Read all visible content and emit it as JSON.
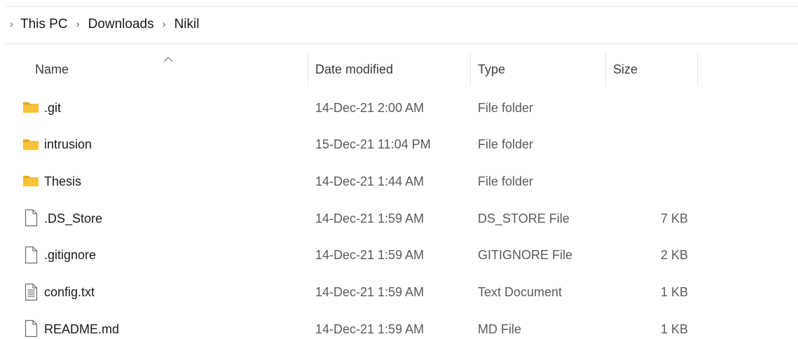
{
  "breadcrumb": {
    "items": [
      "This PC",
      "Downloads",
      "Nikil"
    ]
  },
  "columns": {
    "name": "Name",
    "date_modified": "Date modified",
    "type": "Type",
    "size": "Size"
  },
  "sort": {
    "column": "name",
    "direction": "ascending"
  },
  "colors": {
    "folder": "#f8c23a",
    "folder_dark": "#e3a81b",
    "file_outline": "#6b6b6b",
    "text": "#1a1a1a",
    "muted_text": "#5a5a5a"
  },
  "files": [
    {
      "name": ".git",
      "date": "14-Dec-21 2:00 AM",
      "type": "File folder",
      "size": "",
      "icon": "folder-icon"
    },
    {
      "name": "intrusion",
      "date": "15-Dec-21 11:04 PM",
      "type": "File folder",
      "size": "",
      "icon": "folder-icon"
    },
    {
      "name": "Thesis",
      "date": "14-Dec-21 1:44 AM",
      "type": "File folder",
      "size": "",
      "icon": "folder-icon"
    },
    {
      "name": ".DS_Store",
      "date": "14-Dec-21 1:59 AM",
      "type": "DS_STORE File",
      "size": "7 KB",
      "icon": "file-icon"
    },
    {
      "name": ".gitignore",
      "date": "14-Dec-21 1:59 AM",
      "type": "GITIGNORE File",
      "size": "2 KB",
      "icon": "file-icon"
    },
    {
      "name": "config.txt",
      "date": "14-Dec-21 1:59 AM",
      "type": "Text Document",
      "size": "1 KB",
      "icon": "text-document-icon"
    },
    {
      "name": "README.md",
      "date": "14-Dec-21 1:59 AM",
      "type": "MD File",
      "size": "1 KB",
      "icon": "file-icon"
    }
  ]
}
